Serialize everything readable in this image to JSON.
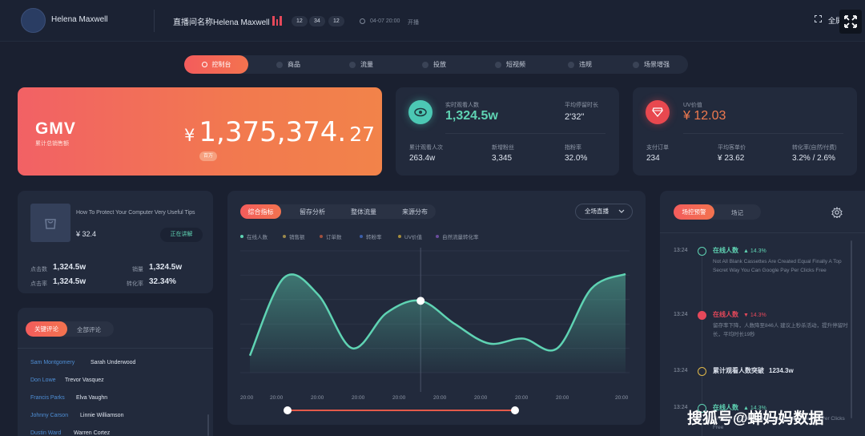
{
  "header": {
    "user_name": "Helena Maxwell",
    "room_name": "直播间名称Helena Maxwell",
    "counters": [
      "12",
      "34",
      "12"
    ],
    "date": "04-07 20:00",
    "status": "开播",
    "fullscreen_label": "全屏"
  },
  "tabs": [
    "控制台",
    "商品",
    "流量",
    "投放",
    "短视频",
    "违规",
    "场景增强"
  ],
  "gmv": {
    "title": "GMV",
    "subtitle": "累计总销售额",
    "currency": "¥",
    "value_int": "1,375,374.",
    "value_dec": "27",
    "unit": "百万"
  },
  "viewers": {
    "label": "实时观看人数",
    "value": "1,324.5w",
    "stay_label": "平均停留时长",
    "stay_value": "2'32\"",
    "stats": [
      {
        "label": "累计观看人次",
        "value": "263.4w"
      },
      {
        "label": "新增粉丝",
        "value": "3,345"
      },
      {
        "label": "指粉率",
        "value": "32.0%"
      }
    ]
  },
  "uv": {
    "label": "UV价值",
    "value": "¥ 12.03",
    "stats": [
      {
        "label": "支付订单",
        "value": "234"
      },
      {
        "label": "平均客单价",
        "value": "¥ 23.62"
      },
      {
        "label": "转化率(自然/付费)",
        "value": "3.2% / 2.6%"
      }
    ]
  },
  "product": {
    "title": "How To Protect Your Computer Very Useful Tips",
    "price": "¥ 32.4",
    "status": "正在讲解",
    "stats": [
      {
        "label": "点击数",
        "value": "1,324.5w"
      },
      {
        "label": "销量",
        "value": "1,324.5w"
      },
      {
        "label": "点击率",
        "value": "1,324.5w"
      },
      {
        "label": "转化率",
        "value": "32.34%"
      }
    ]
  },
  "comments": {
    "tabs": [
      "关键评论",
      "全部评论"
    ],
    "rows": [
      {
        "user": "Sam Montgomery",
        "text": "Sarah Underwood"
      },
      {
        "user": "Don Lowe",
        "text": "Trevor Vasquez"
      },
      {
        "user": "Francis Parks",
        "text": "Elva Vaughn"
      },
      {
        "user": "Johnny Carson",
        "text": "Linnie Williamson"
      },
      {
        "user": "Dustin Ward",
        "text": "Warren Cortez"
      }
    ]
  },
  "chart": {
    "tabs": [
      "综合指标",
      "留存分析",
      "整体流量",
      "来源分布"
    ],
    "dropdown": "全场直播",
    "legend": [
      {
        "name": "在线人数",
        "color": "#5fd3b3"
      },
      {
        "name": "销售额",
        "color": "#9c8a4c"
      },
      {
        "name": "订单数",
        "color": "#a0503f"
      },
      {
        "name": "转粉率",
        "color": "#3b5ea8"
      },
      {
        "name": "UV价值",
        "color": "#a58c3c"
      },
      {
        "name": "自然流量转化率",
        "color": "#6a4c9c"
      }
    ]
  },
  "chart_data": {
    "type": "area",
    "x": [
      "20:00",
      "20:00",
      "20:00",
      "20:00",
      "20:00",
      "20:00",
      "20:00",
      "20:00",
      "20:00",
      "20:00"
    ],
    "series": [
      {
        "name": "在线人数",
        "values": [
          1.4,
          7.8,
          6.4,
          2.0,
          4.9,
          5.9,
          4.0,
          2.4,
          2.8,
          2.0,
          6.9,
          8.1
        ]
      }
    ],
    "ylim": [
      0,
      10
    ],
    "grid": true,
    "highlight_index": 5,
    "range_slider": [
      0.0,
      0.5
    ]
  },
  "alerts": {
    "tabs": [
      "场控预警",
      "场记"
    ],
    "items": [
      {
        "time": "13:24",
        "title": "在线人数",
        "delta": "▲ 14.3%",
        "kind": "up",
        "text": "Not All Blank Cassettes Are Created Equal Finally A Top Secret Way You Can Google Pay Per Clicks Free"
      },
      {
        "time": "13:24",
        "title": "在线人数",
        "delta": "▼ 14.3%",
        "kind": "down",
        "text": "留存率下降，人数降至846人 建议上秒杀活动，提升停留时长，平均时长19秒"
      },
      {
        "time": "13:24",
        "title": "累计观看人数突破",
        "delta": "1234.3w",
        "kind": "info",
        "text": ""
      },
      {
        "time": "13:24",
        "title": "在线人数",
        "delta": "▲ 14.3%",
        "kind": "up",
        "text": "Finally A Top Secret Way You Can Google Pay Per Clicks Free"
      }
    ]
  },
  "watermark": "搜狐号@蝉妈妈数据",
  "colors": {
    "accent": "#f3674f",
    "teal": "#5fd3b3",
    "red": "#e5485a",
    "bg": "#1a2030",
    "card": "#222a3c"
  }
}
